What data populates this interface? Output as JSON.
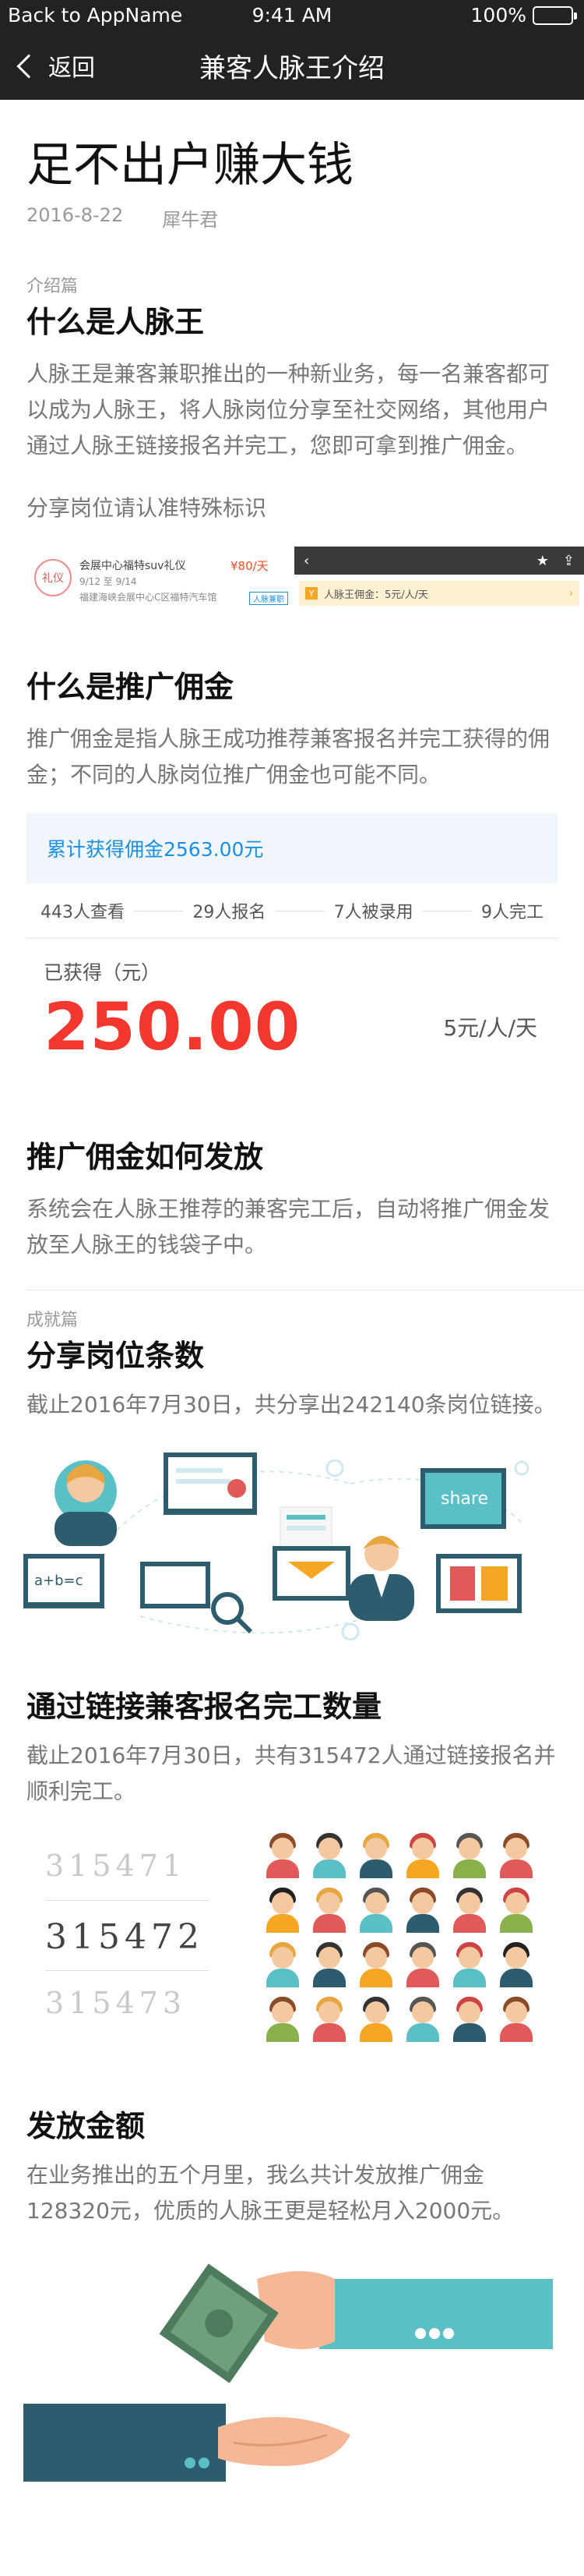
{
  "status_bar": {
    "back_label": "Back to AppName",
    "time": "9:41 AM",
    "battery": "100%"
  },
  "nav": {
    "back_label": "返回",
    "title": "兼客人脉王介绍"
  },
  "article": {
    "title": "足不出户赚大钱",
    "date": "2016-8-22",
    "author": "犀牛君"
  },
  "intro": {
    "section_label": "介绍篇",
    "heading": "什么是人脉王",
    "body": "人脉王是兼客兼职推出的一种新业务，每一名兼客都可以成为人脉王，将人脉岗位分享至社交网络，其他用户通过人脉王链接报名并完工，您即可拿到推广佣金。",
    "share_note": "分享岗位请认准特殊标识"
  },
  "share_card": {
    "badge": "礼仪",
    "title": "会展中心福特suv礼仪",
    "dates": "9/12 至 9/14",
    "location": "福建海峡会展中心C区福特汽车馆",
    "price": "¥80/天",
    "tag": "人脉兼职",
    "phone_row_icon": "Y",
    "phone_row_text": "人脉王佣金：5元/人/天",
    "phone_row_arrow": "›",
    "phone_back": "‹",
    "phone_star": "★",
    "phone_share": "⇪"
  },
  "commission": {
    "heading": "什么是推广佣金",
    "body": "推广佣金是指人脉王成功推荐兼客报名并完工获得的佣金；不同的人脉岗位推广佣金也可能不同。",
    "total": "累计获得佣金2563.00元",
    "stats": [
      "443人查看",
      "29人报名",
      "7人被录用",
      "9人完工"
    ],
    "earned_label": "已获得（元）",
    "earned_amount": "250.00",
    "rate": "5元/人/天"
  },
  "payout": {
    "heading": "推广佣金如何发放",
    "body": "系统会在人脉王推荐的兼客完工后，自动将推广佣金发放至人脉王的钱袋子中。"
  },
  "achievements": {
    "section_label": "成就篇",
    "heading": "分享岗位条数",
    "body": "截止2016年7月30日，共分享出242140条岗位链接。",
    "illus_share_text": "share",
    "illus_board_text": "a+b=c"
  },
  "signups": {
    "heading": "通过链接兼客报名完工数量",
    "body": "截止2016年7月30日，共有315472人通过链接报名并顺利完工。",
    "counter_prev": "315471",
    "counter_current": "315472",
    "counter_next": "315473"
  },
  "amount": {
    "heading": "发放金额",
    "body": "在业务推出的五个月里，我么共计发放推广佣金128320元，优质的人脉王更是轻松月入2000元。"
  },
  "colors": {
    "nav_bg": "#222222",
    "accent_red": "#f2382e",
    "accent_blue": "#1d8fe1",
    "illus_teal": "#5bbfc6",
    "illus_dark": "#2d5c6e"
  }
}
